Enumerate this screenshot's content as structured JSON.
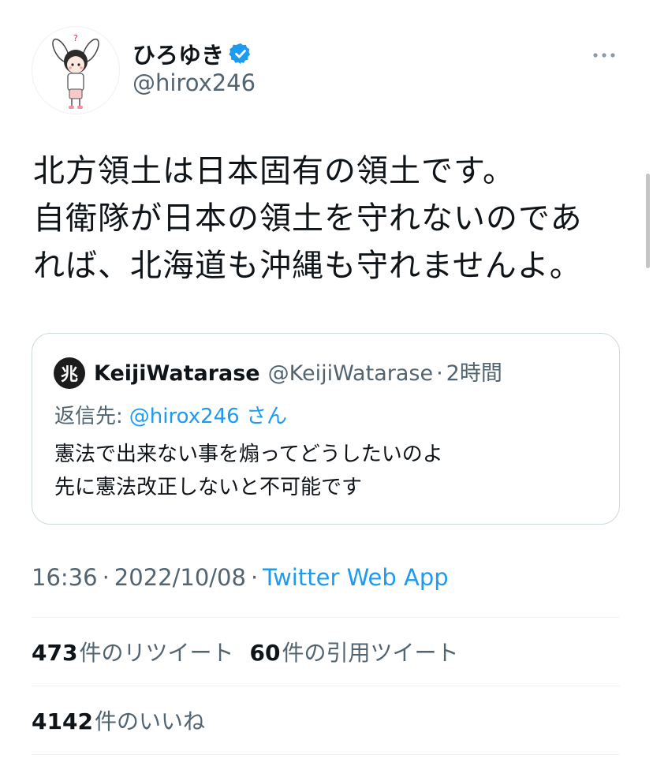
{
  "author": {
    "display_name": "ひろゆき",
    "handle": "@hirox246",
    "verified": true,
    "avatar_icon": "avatar-icon",
    "more_icon": "more-horizontal-icon"
  },
  "tweet": {
    "text_lines": [
      "北方領土は日本固有の領土です。",
      "自衛隊が日本の領土を守れないのであ",
      "れば、北海道も沖縄も守れませんよ。"
    ]
  },
  "quoted": {
    "avatar_glyph": "兆",
    "display_name": "KeijiWatarase",
    "handle": "@KeijiWatarase",
    "separator": "·",
    "time": "2時間",
    "reply_prefix": "返信先:",
    "reply_to": "@hirox246 さん",
    "text_lines": [
      "憲法で出来ない事を煽ってどうしたいのよ",
      "先に憲法改正しないと不可能です"
    ]
  },
  "meta": {
    "time": "16:36",
    "separator": "·",
    "date": "2022/10/08",
    "source": "Twitter Web App"
  },
  "stats": {
    "retweets_count": "473",
    "retweets_label": "件のリツイート",
    "quotes_count": "60",
    "quotes_label": "件の引用ツイート",
    "likes_count": "4142",
    "likes_label": "件のいいね"
  },
  "colors": {
    "link": "#1d9bf0",
    "secondary_text": "#536471",
    "primary_text": "#0f1419",
    "border": "#cfd9de"
  }
}
